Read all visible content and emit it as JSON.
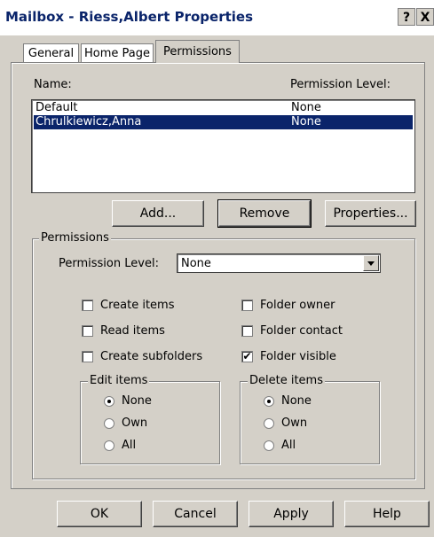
{
  "window": {
    "title": "Mailbox - Riess,Albert Properties",
    "help_button": "?",
    "close_button": "X"
  },
  "tabs": [
    {
      "label": "General",
      "active": false
    },
    {
      "label": "Home Page",
      "active": false
    },
    {
      "label": "Permissions",
      "active": true
    }
  ],
  "list": {
    "name_header": "Name:",
    "level_header": "Permission Level:",
    "rows": [
      {
        "name": "Default",
        "level": "None",
        "selected": false
      },
      {
        "name": "Chrulkiewicz,Anna",
        "level": "None",
        "selected": true
      }
    ]
  },
  "list_buttons": {
    "add": "Add...",
    "remove": "Remove",
    "properties": "Properties..."
  },
  "permissions": {
    "group_title": "Permissions",
    "level_label": "Permission Level:",
    "level_value": "None",
    "checkboxes": {
      "create_items": {
        "label": "Create items",
        "checked": false
      },
      "read_items": {
        "label": "Read items",
        "checked": false
      },
      "create_subfolders": {
        "label": "Create subfolders",
        "checked": false
      },
      "folder_owner": {
        "label": "Folder owner",
        "checked": false
      },
      "folder_contact": {
        "label": "Folder contact",
        "checked": false
      },
      "folder_visible": {
        "label": "Folder visible",
        "checked": true
      }
    },
    "edit_items": {
      "title": "Edit items",
      "options": [
        {
          "label": "None",
          "selected": true
        },
        {
          "label": "Own",
          "selected": false
        },
        {
          "label": "All",
          "selected": false
        }
      ]
    },
    "delete_items": {
      "title": "Delete items",
      "options": [
        {
          "label": "None",
          "selected": true
        },
        {
          "label": "Own",
          "selected": false
        },
        {
          "label": "All",
          "selected": false
        }
      ]
    }
  },
  "footer": {
    "ok": "OK",
    "cancel": "Cancel",
    "apply": "Apply",
    "help": "Help"
  },
  "check_mark": "✔"
}
